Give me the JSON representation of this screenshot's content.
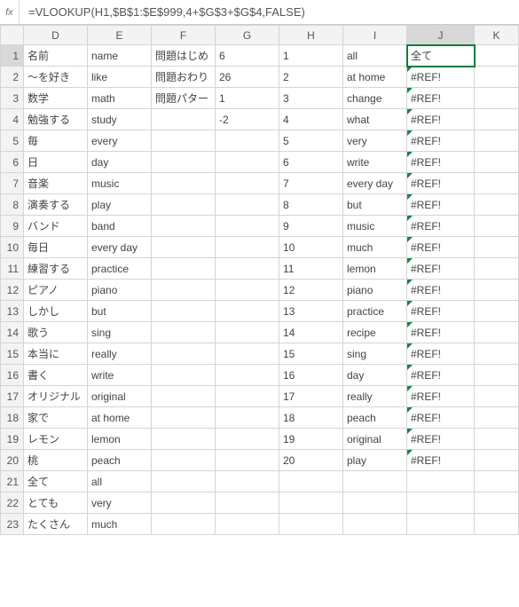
{
  "formula_bar": {
    "fx": "fx",
    "formula": "=VLOOKUP(H1,$B$1:$E$999,4+$G$3+$G$4,FALSE)"
  },
  "columns": [
    "D",
    "E",
    "F",
    "G",
    "H",
    "I",
    "J",
    "K"
  ],
  "active_cell": {
    "row": 1,
    "col": "J"
  },
  "rows": [
    {
      "n": 1,
      "D": "名前",
      "E": "name",
      "F": "問題はじめ",
      "G": "6",
      "H": "1",
      "I": "all",
      "J": "全て"
    },
    {
      "n": 2,
      "D": "～を好き",
      "E": "like",
      "F": "問題おわり",
      "G": "26",
      "H": "2",
      "I": "at home",
      "J": "#REF!"
    },
    {
      "n": 3,
      "D": "数学",
      "E": "math",
      "F": "問題パター",
      "G": "1",
      "H": "3",
      "I": "change",
      "J": "#REF!"
    },
    {
      "n": 4,
      "D": "勉強する",
      "E": "study",
      "F": "",
      "G": "-2",
      "H": "4",
      "I": "what",
      "J": "#REF!"
    },
    {
      "n": 5,
      "D": "毎",
      "E": "every",
      "F": "",
      "G": "",
      "H": "5",
      "I": "very",
      "J": "#REF!"
    },
    {
      "n": 6,
      "D": "日",
      "E": "day",
      "F": "",
      "G": "",
      "H": "6",
      "I": "write",
      "J": "#REF!"
    },
    {
      "n": 7,
      "D": "音楽",
      "E": "music",
      "F": "",
      "G": "",
      "H": "7",
      "I": "every day",
      "J": "#REF!"
    },
    {
      "n": 8,
      "D": "演奏する",
      "E": "play",
      "F": "",
      "G": "",
      "H": "8",
      "I": "but",
      "J": "#REF!"
    },
    {
      "n": 9,
      "D": "バンド",
      "E": "band",
      "F": "",
      "G": "",
      "H": "9",
      "I": "music",
      "J": "#REF!"
    },
    {
      "n": 10,
      "D": "毎日",
      "E": "every day",
      "F": "",
      "G": "",
      "H": "10",
      "I": "much",
      "J": "#REF!"
    },
    {
      "n": 11,
      "D": "練習する",
      "E": "practice",
      "F": "",
      "G": "",
      "H": "11",
      "I": "lemon",
      "J": "#REF!"
    },
    {
      "n": 12,
      "D": "ピアノ",
      "E": "piano",
      "F": "",
      "G": "",
      "H": "12",
      "I": "piano",
      "J": "#REF!"
    },
    {
      "n": 13,
      "D": "しかし",
      "E": "but",
      "F": "",
      "G": "",
      "H": "13",
      "I": "practice",
      "J": "#REF!"
    },
    {
      "n": 14,
      "D": "歌う",
      "E": "sing",
      "F": "",
      "G": "",
      "H": "14",
      "I": "recipe",
      "J": "#REF!"
    },
    {
      "n": 15,
      "D": "本当に",
      "E": "really",
      "F": "",
      "G": "",
      "H": "15",
      "I": "sing",
      "J": "#REF!"
    },
    {
      "n": 16,
      "D": "書く",
      "E": "write",
      "F": "",
      "G": "",
      "H": "16",
      "I": "day",
      "J": "#REF!"
    },
    {
      "n": 17,
      "D": "オリジナル",
      "E": "original",
      "F": "",
      "G": "",
      "H": "17",
      "I": "really",
      "J": "#REF!"
    },
    {
      "n": 18,
      "D": "家で",
      "E": "at home",
      "F": "",
      "G": "",
      "H": "18",
      "I": "peach",
      "J": "#REF!"
    },
    {
      "n": 19,
      "D": "レモン",
      "E": "lemon",
      "F": "",
      "G": "",
      "H": "19",
      "I": "original",
      "J": "#REF!"
    },
    {
      "n": 20,
      "D": "桃",
      "E": "peach",
      "F": "",
      "G": "",
      "H": "20",
      "I": "play",
      "J": "#REF!"
    },
    {
      "n": 21,
      "D": "全て",
      "E": "all",
      "F": "",
      "G": "",
      "H": "",
      "I": "",
      "J": ""
    },
    {
      "n": 22,
      "D": "とても",
      "E": "very",
      "F": "",
      "G": "",
      "H": "",
      "I": "",
      "J": ""
    },
    {
      "n": 23,
      "D": "たくさん",
      "E": "much",
      "F": "",
      "G": "",
      "H": "",
      "I": "",
      "J": ""
    }
  ]
}
